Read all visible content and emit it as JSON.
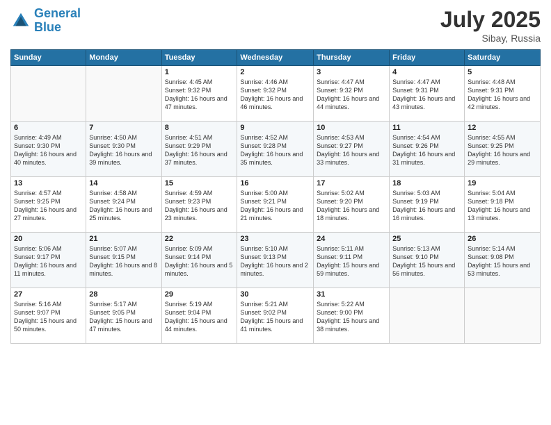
{
  "logo": {
    "line1": "General",
    "line2": "Blue"
  },
  "title": "July 2025",
  "subtitle": "Sibay, Russia",
  "days_of_week": [
    "Sunday",
    "Monday",
    "Tuesday",
    "Wednesday",
    "Thursday",
    "Friday",
    "Saturday"
  ],
  "weeks": [
    [
      {
        "day": "",
        "info": ""
      },
      {
        "day": "",
        "info": ""
      },
      {
        "day": "1",
        "info": "Sunrise: 4:45 AM\nSunset: 9:32 PM\nDaylight: 16 hours and 47 minutes."
      },
      {
        "day": "2",
        "info": "Sunrise: 4:46 AM\nSunset: 9:32 PM\nDaylight: 16 hours and 46 minutes."
      },
      {
        "day": "3",
        "info": "Sunrise: 4:47 AM\nSunset: 9:32 PM\nDaylight: 16 hours and 44 minutes."
      },
      {
        "day": "4",
        "info": "Sunrise: 4:47 AM\nSunset: 9:31 PM\nDaylight: 16 hours and 43 minutes."
      },
      {
        "day": "5",
        "info": "Sunrise: 4:48 AM\nSunset: 9:31 PM\nDaylight: 16 hours and 42 minutes."
      }
    ],
    [
      {
        "day": "6",
        "info": "Sunrise: 4:49 AM\nSunset: 9:30 PM\nDaylight: 16 hours and 40 minutes."
      },
      {
        "day": "7",
        "info": "Sunrise: 4:50 AM\nSunset: 9:30 PM\nDaylight: 16 hours and 39 minutes."
      },
      {
        "day": "8",
        "info": "Sunrise: 4:51 AM\nSunset: 9:29 PM\nDaylight: 16 hours and 37 minutes."
      },
      {
        "day": "9",
        "info": "Sunrise: 4:52 AM\nSunset: 9:28 PM\nDaylight: 16 hours and 35 minutes."
      },
      {
        "day": "10",
        "info": "Sunrise: 4:53 AM\nSunset: 9:27 PM\nDaylight: 16 hours and 33 minutes."
      },
      {
        "day": "11",
        "info": "Sunrise: 4:54 AM\nSunset: 9:26 PM\nDaylight: 16 hours and 31 minutes."
      },
      {
        "day": "12",
        "info": "Sunrise: 4:55 AM\nSunset: 9:25 PM\nDaylight: 16 hours and 29 minutes."
      }
    ],
    [
      {
        "day": "13",
        "info": "Sunrise: 4:57 AM\nSunset: 9:25 PM\nDaylight: 16 hours and 27 minutes."
      },
      {
        "day": "14",
        "info": "Sunrise: 4:58 AM\nSunset: 9:24 PM\nDaylight: 16 hours and 25 minutes."
      },
      {
        "day": "15",
        "info": "Sunrise: 4:59 AM\nSunset: 9:23 PM\nDaylight: 16 hours and 23 minutes."
      },
      {
        "day": "16",
        "info": "Sunrise: 5:00 AM\nSunset: 9:21 PM\nDaylight: 16 hours and 21 minutes."
      },
      {
        "day": "17",
        "info": "Sunrise: 5:02 AM\nSunset: 9:20 PM\nDaylight: 16 hours and 18 minutes."
      },
      {
        "day": "18",
        "info": "Sunrise: 5:03 AM\nSunset: 9:19 PM\nDaylight: 16 hours and 16 minutes."
      },
      {
        "day": "19",
        "info": "Sunrise: 5:04 AM\nSunset: 9:18 PM\nDaylight: 16 hours and 13 minutes."
      }
    ],
    [
      {
        "day": "20",
        "info": "Sunrise: 5:06 AM\nSunset: 9:17 PM\nDaylight: 16 hours and 11 minutes."
      },
      {
        "day": "21",
        "info": "Sunrise: 5:07 AM\nSunset: 9:15 PM\nDaylight: 16 hours and 8 minutes."
      },
      {
        "day": "22",
        "info": "Sunrise: 5:09 AM\nSunset: 9:14 PM\nDaylight: 16 hours and 5 minutes."
      },
      {
        "day": "23",
        "info": "Sunrise: 5:10 AM\nSunset: 9:13 PM\nDaylight: 16 hours and 2 minutes."
      },
      {
        "day": "24",
        "info": "Sunrise: 5:11 AM\nSunset: 9:11 PM\nDaylight: 15 hours and 59 minutes."
      },
      {
        "day": "25",
        "info": "Sunrise: 5:13 AM\nSunset: 9:10 PM\nDaylight: 15 hours and 56 minutes."
      },
      {
        "day": "26",
        "info": "Sunrise: 5:14 AM\nSunset: 9:08 PM\nDaylight: 15 hours and 53 minutes."
      }
    ],
    [
      {
        "day": "27",
        "info": "Sunrise: 5:16 AM\nSunset: 9:07 PM\nDaylight: 15 hours and 50 minutes."
      },
      {
        "day": "28",
        "info": "Sunrise: 5:17 AM\nSunset: 9:05 PM\nDaylight: 15 hours and 47 minutes."
      },
      {
        "day": "29",
        "info": "Sunrise: 5:19 AM\nSunset: 9:04 PM\nDaylight: 15 hours and 44 minutes."
      },
      {
        "day": "30",
        "info": "Sunrise: 5:21 AM\nSunset: 9:02 PM\nDaylight: 15 hours and 41 minutes."
      },
      {
        "day": "31",
        "info": "Sunrise: 5:22 AM\nSunset: 9:00 PM\nDaylight: 15 hours and 38 minutes."
      },
      {
        "day": "",
        "info": ""
      },
      {
        "day": "",
        "info": ""
      }
    ]
  ]
}
